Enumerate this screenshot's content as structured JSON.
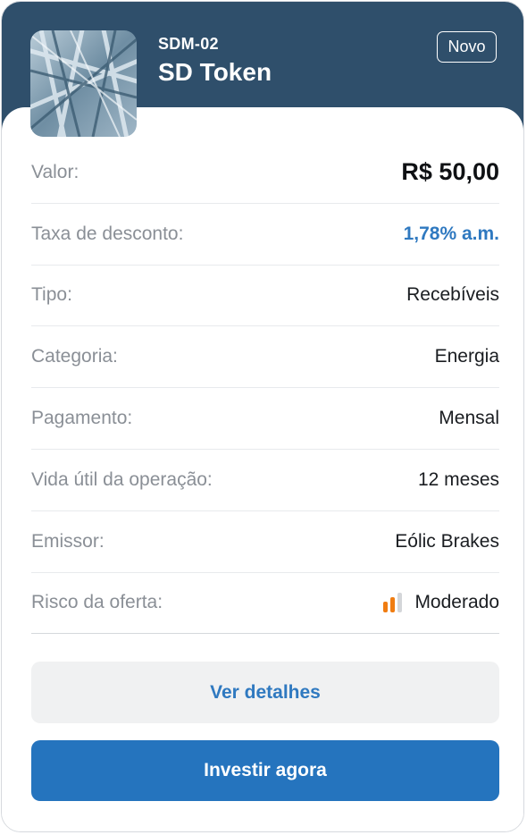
{
  "header": {
    "code": "SDM-02",
    "title": "SD Token",
    "badge": "Novo"
  },
  "details": {
    "value_label": "Valor:",
    "value": "R$ 50,00",
    "rate_label": "Taxa de desconto:",
    "rate": "1,78% a.m.",
    "type_label": "Tipo:",
    "type": "Recebíveis",
    "category_label": "Categoria:",
    "category": "Energia",
    "payment_label": "Pagamento:",
    "payment": "Mensal",
    "lifetime_label": "Vida útil da operação:",
    "lifetime": "12 meses",
    "issuer_label": "Emissor:",
    "issuer": "Eólic Brakes",
    "risk_label": "Risco da oferta:",
    "risk": "Moderado",
    "risk_icon": "signal-bars-icon",
    "risk_level": 2,
    "risk_max": 3
  },
  "actions": {
    "details_label": "Ver detalhes",
    "invest_label": "Investir agora"
  },
  "colors": {
    "header_bg": "#2f4f6b",
    "accent_blue": "#2574be",
    "rate_blue": "#2f79c0",
    "risk_active": "#f07d12",
    "risk_inactive": "#d4d6d9"
  }
}
